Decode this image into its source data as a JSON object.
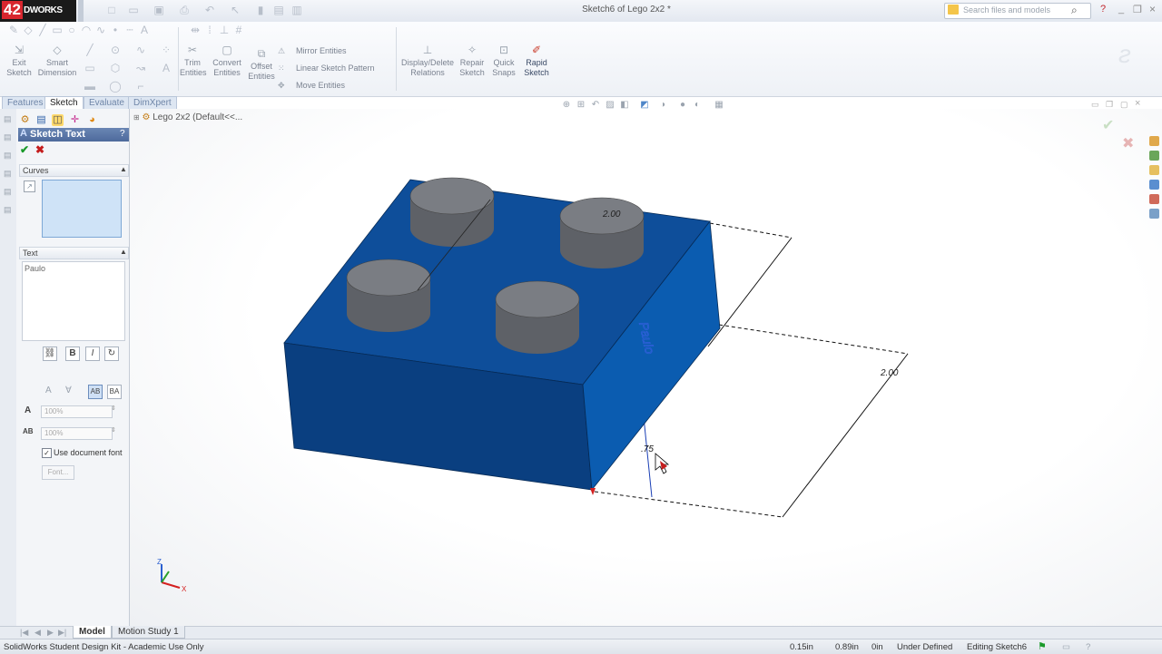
{
  "app": {
    "logo_number": "42",
    "logo_text": "DWORKS",
    "document_title": "Sketch6 of Lego 2x2 *",
    "search_placeholder": "Search files and models"
  },
  "ribbon": {
    "exit_sketch": [
      "Exit",
      "Sketch"
    ],
    "smart_dimension": [
      "Smart",
      "Dimension"
    ],
    "trim_entities": [
      "Trim",
      "Entities"
    ],
    "convert_entities": [
      "Convert",
      "Entities"
    ],
    "offset_entities": [
      "Offset",
      "Entities"
    ],
    "mirror_entities": "Mirror Entities",
    "linear_sketch_pattern": "Linear Sketch Pattern",
    "move_entities": "Move Entities",
    "display_delete_relations": [
      "Display/Delete",
      "Relations"
    ],
    "repair_sketch": [
      "Repair",
      "Sketch"
    ],
    "quick_snaps": [
      "Quick",
      "Snaps"
    ],
    "rapid_sketch": [
      "Rapid",
      "Sketch"
    ]
  },
  "command_tabs": [
    "Features",
    "Sketch",
    "Evaluate",
    "DimXpert"
  ],
  "property_manager": {
    "title": "Sketch Text",
    "help": "?",
    "curves_label": "Curves",
    "text_label": "Text",
    "text_value": "Paulo",
    "width_value": "100%",
    "spacing_value": "100%",
    "use_document_font": "Use document font",
    "font_button": "Font..."
  },
  "feature_tree": {
    "root": "Lego 2x2  (Default<<..."
  },
  "dimensions": {
    "top_edge": "2.00",
    "right_edge": "2.00",
    "height": ".75",
    "sketch_text": "Paulo"
  },
  "bottom_tabs": [
    "Model",
    "Motion Study 1"
  ],
  "status": {
    "app_name": "SolidWorks Student Design Kit - Academic Use Only",
    "x": "0.15in",
    "y": "0.89in",
    "z": "0in",
    "state": "Under Defined",
    "mode": "Editing Sketch6"
  },
  "colors": {
    "brick_top": "#0e4e9a",
    "brick_front": "#0a3f80",
    "brick_side": "#0b5cb0",
    "stud": "#6b6e74",
    "header": "#5674a6"
  }
}
